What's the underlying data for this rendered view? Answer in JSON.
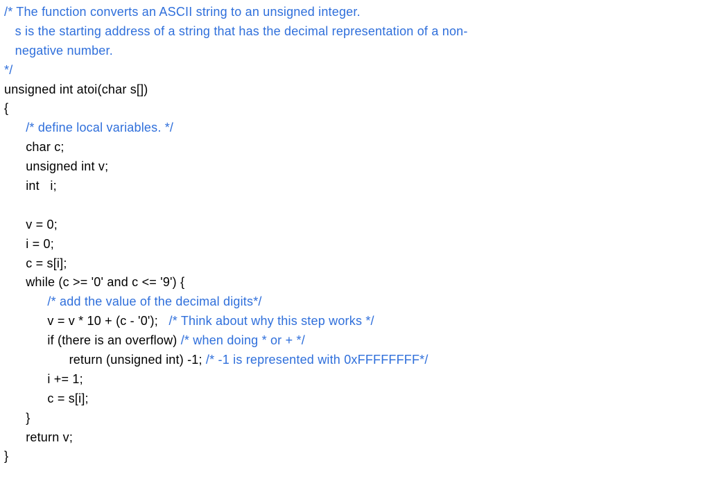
{
  "code": {
    "l01": "/* The function converts an ASCII string to an unsigned integer.",
    "l02": "   s is the starting address of a string that has the decimal representation of a non-",
    "l03": "   negative number.",
    "l04": "*/",
    "l05": "unsigned int atoi(char s[])",
    "l06": "{",
    "l07a": "      ",
    "l07b": "/* define local variables. */",
    "l08": "      char c;",
    "l09": "      unsigned int v;",
    "l10": "      int   i;",
    "blank1": "",
    "l11": "      v = 0;",
    "l12": "      i = 0;",
    "l13": "      c = s[i];",
    "l14": "      while (c >= '0' and c <= '9') {",
    "l15a": "            ",
    "l15b": "/* add the value of the decimal digits*/",
    "l16a": "            v = v * 10 + (c - '0');   ",
    "l16b": "/* Think about why this step works */",
    "l17a": "            if (there is an overflow) ",
    "l17b": "/* when doing * or + */",
    "l18a": "                  return (unsigned int) -1; ",
    "l18b": "/* -1 is represented with 0xFFFFFFFF*/",
    "l19": "            i += 1;",
    "l20": "            c = s[i];",
    "l21": "      }",
    "l22": "      return v;",
    "l23": "}"
  }
}
